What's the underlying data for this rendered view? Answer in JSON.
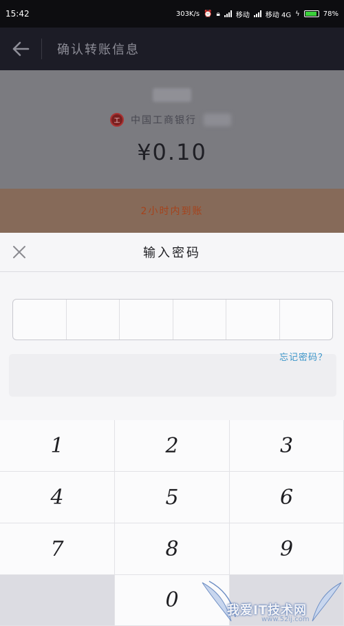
{
  "statusbar": {
    "time": "15:42",
    "speed": "303K/s",
    "carrier1": "移动",
    "carrier2": "移动 4G",
    "battery": "78%",
    "battery_level": 0.78
  },
  "appbar": {
    "title": "确认转账信息",
    "back_icon": "back-arrow-icon"
  },
  "transfer": {
    "bank_name": "中国工商银行",
    "amount": "¥0.10",
    "arrival_note": "2小时内到账"
  },
  "password_sheet": {
    "title": "输入密码",
    "close_icon": "close-icon",
    "digit_count": 6,
    "forgot_label": "忘记密码？"
  },
  "keypad": {
    "keys": [
      "1",
      "2",
      "3",
      "4",
      "5",
      "6",
      "7",
      "8",
      "9",
      "",
      "0",
      ""
    ]
  },
  "watermark": {
    "text": "我爱IT技术网",
    "url": "www.52ij.com"
  },
  "colors": {
    "appbar_bg": "#1c1c26",
    "accent_link": "#3b95c9",
    "arrival_text": "#a5431c"
  }
}
